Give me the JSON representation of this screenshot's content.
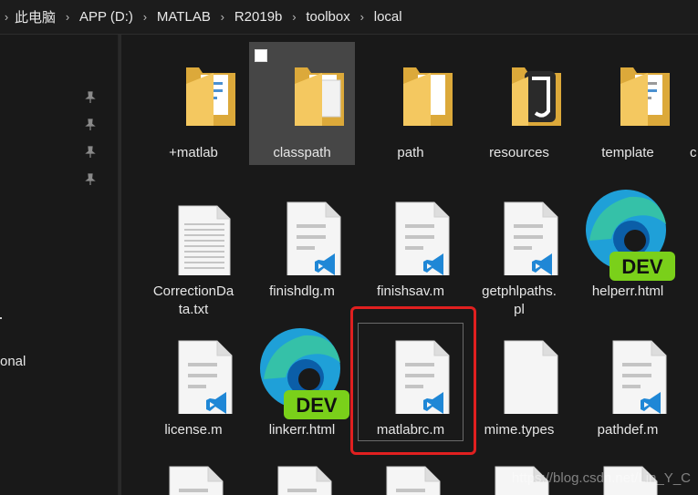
{
  "breadcrumb": [
    "此电脑",
    "APP (D:)",
    "MATLAB",
    "R2019b",
    "toolbox",
    "local"
  ],
  "nav": {
    "partial_label": "onal"
  },
  "files": [
    {
      "name": "+matlab",
      "icon": "folder-icon"
    },
    {
      "name": "classpath",
      "icon": "folder-icon",
      "selected": true
    },
    {
      "name": "path",
      "icon": "folder-icon"
    },
    {
      "name": "resources",
      "icon": "folder-icon"
    },
    {
      "name": "template",
      "icon": "folder-icon"
    },
    {
      "name": "c",
      "icon": "folder-icon"
    },
    {
      "name": "CorrectionDa",
      "name2": "ta.txt",
      "icon": "text-file-icon"
    },
    {
      "name": "finishdlg.m",
      "icon": "vscode-file-icon"
    },
    {
      "name": "finishsav.m",
      "icon": "vscode-file-icon"
    },
    {
      "name": "getphlpaths.",
      "name2": "pl",
      "icon": "vscode-file-icon"
    },
    {
      "name": "helperr.html",
      "icon": "edge-dev-icon"
    },
    {
      "name": "license.m",
      "icon": "vscode-file-icon"
    },
    {
      "name": "linkerr.html",
      "icon": "edge-dev-icon"
    },
    {
      "name": "matlabrc.m",
      "icon": "vscode-file-icon",
      "highlighted": true
    },
    {
      "name": "mime.types",
      "icon": "blank-file-icon"
    },
    {
      "name": "pathdef.m",
      "icon": "vscode-file-icon"
    }
  ],
  "badge": "DEV",
  "watermark": "https://blog.csdn.net/Lin_Y_C",
  "colors": {
    "folder": "#f4c860",
    "folder_dark": "#dca93a",
    "vscode_blue": "#1f87d6",
    "dev_badge": "#7ad01a",
    "highlight": "#e02020"
  }
}
